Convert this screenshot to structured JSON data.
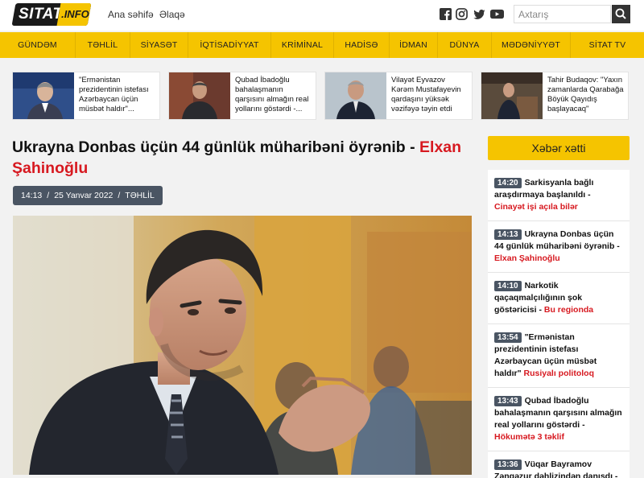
{
  "header": {
    "logo": {
      "left": "SITAT",
      "right": ".INFO"
    },
    "links": [
      "Ana səhifə",
      "Əlaqə"
    ],
    "social_icons": [
      "facebook-icon",
      "instagram-icon",
      "twitter-icon",
      "youtube-icon"
    ],
    "search": {
      "placeholder": "Axtarış",
      "icon": "search-icon"
    }
  },
  "nav": {
    "items": [
      "GÜNDƏM",
      "TƏHLİL",
      "SİYASƏT",
      "İQTİSADİYYAT",
      "KRİMİNAL",
      "HADİSƏ",
      "İDMAN",
      "DÜNYA",
      "MƏDƏNİYYƏT",
      "SİTAT TV"
    ]
  },
  "strip": [
    {
      "text": "\"Ermənistan prezidentinin istefası Azərbaycan üçün müsbət haldır\"..."
    },
    {
      "text": "Qubad İbadoğlu bahalaşmanın qarşısını almağın real yollarını göstərdi -..."
    },
    {
      "text": "Vilayət Eyvazov Kərəm Mustafayevin qardaşını yüksək vəzifəyə təyin etdi"
    },
    {
      "text": "Tahir Budaqov: \"Yaxın zamanlarda Qarabağa Böyük Qayıdış başlayacaq\""
    }
  ],
  "article": {
    "title_main": "Ukrayna Donbas üçün 44 günlük müharibəni öyrənib - ",
    "title_author": "Elxan Şahinoğlu",
    "time": "14:13",
    "date": "25 Yanvar 2022",
    "category": "TƏHLİL"
  },
  "sidebar": {
    "title": "Xəbər xətti",
    "items": [
      {
        "time": "14:20",
        "text": "Sarkisyanla bağlı araşdırmaya başlanıldı - ",
        "tag": "Cinayət işi açıla bilər"
      },
      {
        "time": "14:13",
        "text": "Ukrayna Donbas üçün 44 günlük müharibəni öyrənib - ",
        "tag": "Elxan Şahinoğlu"
      },
      {
        "time": "14:10",
        "text": "Narkotik qaçaqmalçılığının şok göstəricisi - ",
        "tag": "Bu regionda"
      },
      {
        "time": "13:54",
        "text": "\"Ermənistan prezidentinin istefası Azərbaycan üçün müsbət haldır\" ",
        "tag": "Rusiyalı politoloq"
      },
      {
        "time": "13:43",
        "text": "Qubad İbadoğlu bahalaşmanın qarşısını almağın real yollarını göstərdi - ",
        "tag": "Hökumətə 3 təklif"
      },
      {
        "time": "13:36",
        "text": "Vüqar Bayramov Zəngəzur dəhlizindən danışdı - ",
        "tag": ""
      }
    ]
  },
  "colors": {
    "accent": "#f5c400",
    "red": "#d71920",
    "meta_bg": "#4a5563"
  }
}
